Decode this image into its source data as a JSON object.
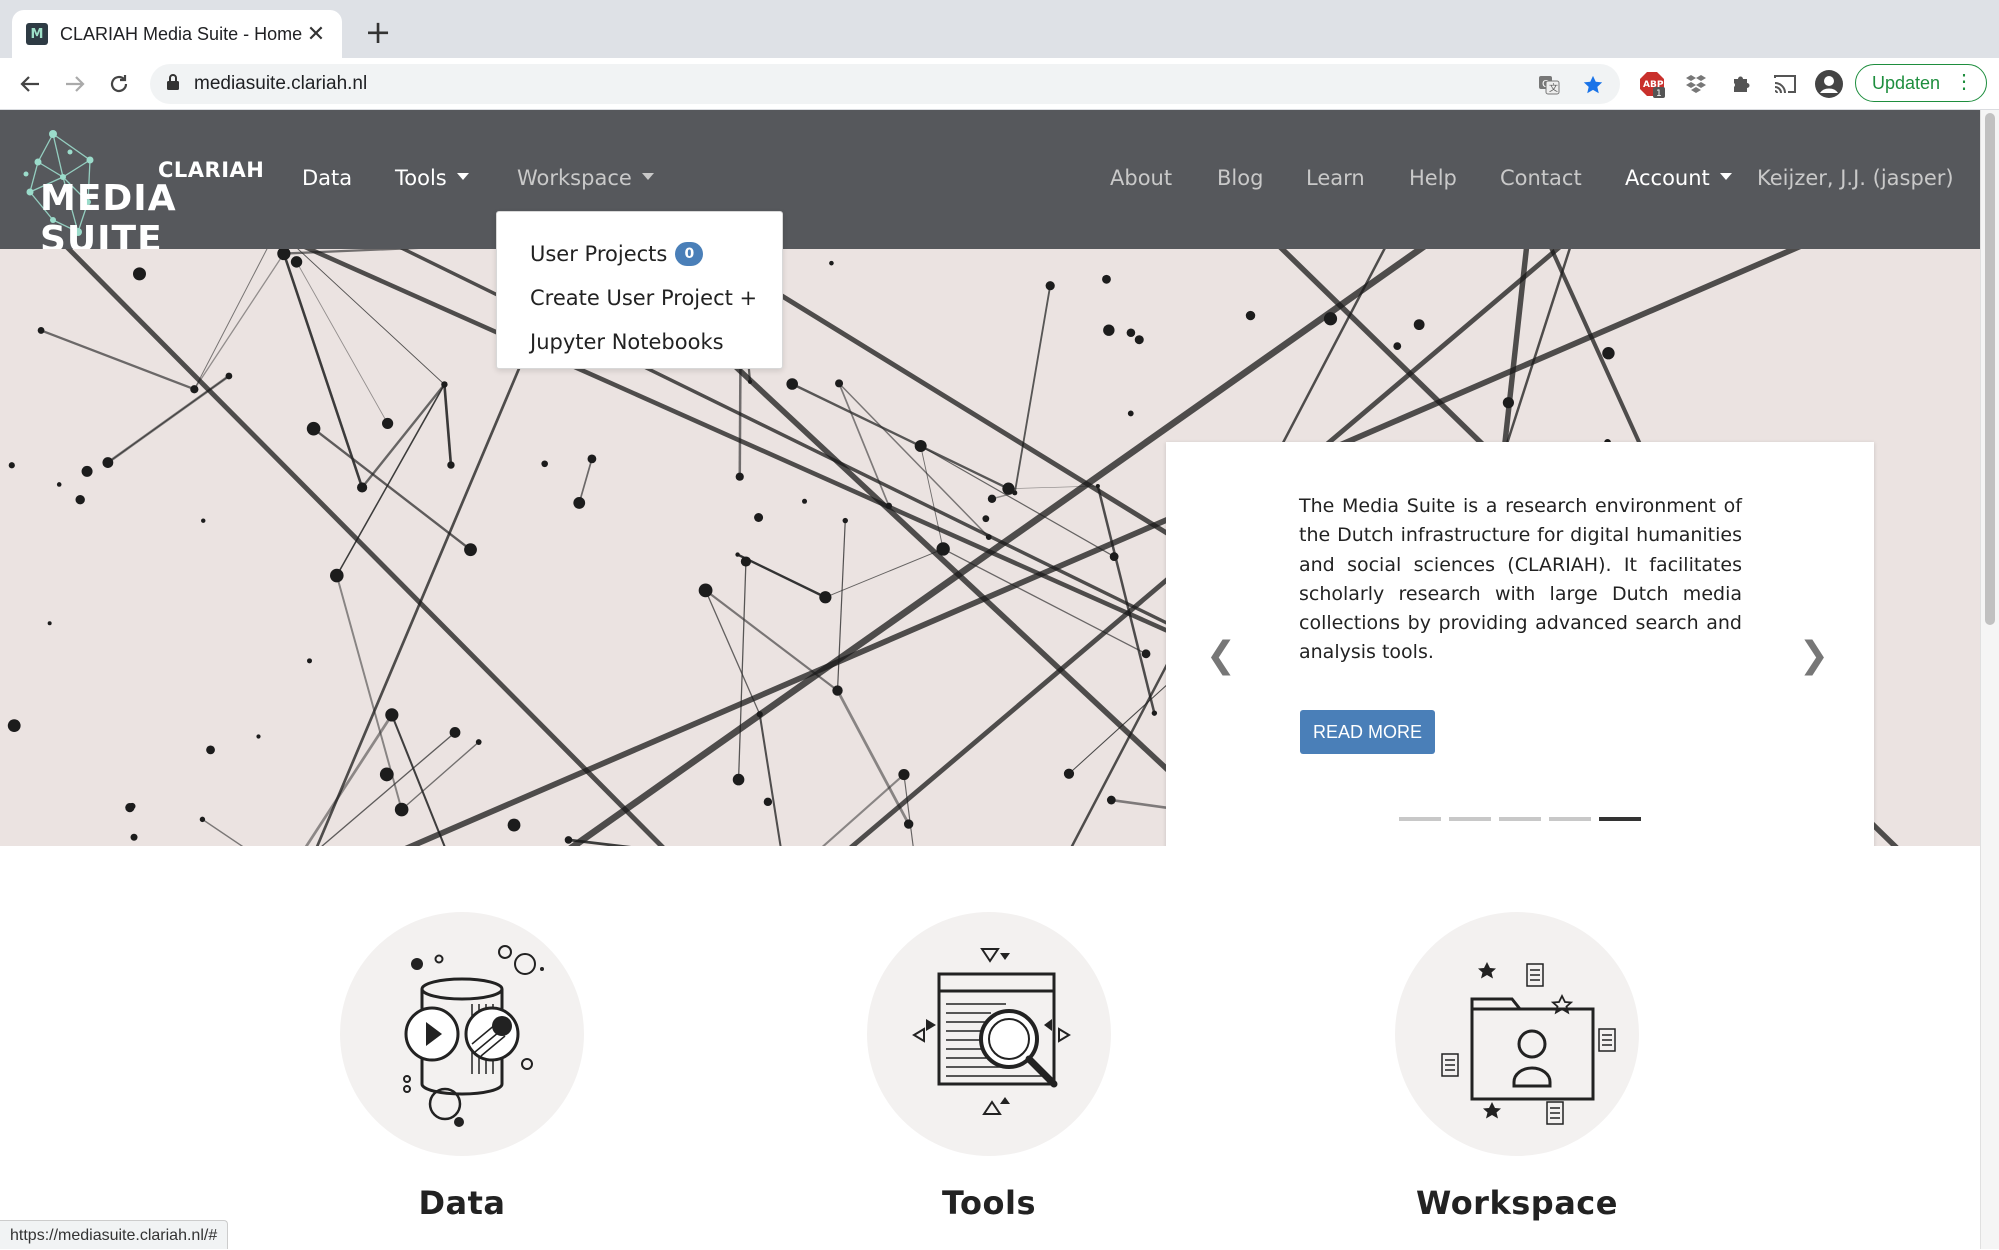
{
  "browser": {
    "tab_title": "CLARIAH Media Suite - Home",
    "favicon_text": "M",
    "url": "mediasuite.clariah.nl",
    "update_label": "Updaten",
    "status_url": "https://mediasuite.clariah.nl/#",
    "abp_count": "1"
  },
  "site": {
    "logo": {
      "line1": "CLARIAH",
      "line2": "MEDIA SUITE"
    },
    "nav_left": [
      {
        "label": "Data"
      },
      {
        "label": "Tools",
        "dropdown": true
      },
      {
        "label": "Workspace",
        "dropdown": true,
        "open": true
      }
    ],
    "nav_right": [
      {
        "label": "About"
      },
      {
        "label": "Blog"
      },
      {
        "label": "Learn"
      },
      {
        "label": "Help"
      },
      {
        "label": "Contact"
      },
      {
        "label": "Account",
        "dropdown": true
      },
      {
        "label": "Keijzer, J.J. (jasper)"
      }
    ],
    "workspace_menu": [
      {
        "label": "User Projects",
        "badge": "0"
      },
      {
        "label": "Create User Project +"
      },
      {
        "label": "Jupyter Notebooks"
      }
    ]
  },
  "carousel": {
    "text": "The Media Suite is a research environment of the Dutch infrastructure for digital humanities and social sciences (CLARIAH). It facilitates scholarly research with large Dutch media collections by providing advanced search and analysis tools.",
    "button_label": "READ MORE",
    "prev_glyph": "❮",
    "next_glyph": "❯",
    "slide_count": 5,
    "active_slide": 5
  },
  "features": [
    {
      "title": "Data",
      "icon": "data-cylinder-icon"
    },
    {
      "title": "Tools",
      "icon": "tools-search-icon"
    },
    {
      "title": "Workspace",
      "icon": "workspace-folder-icon"
    }
  ],
  "cut_text": [
    "... ...",
    "... ... ...",
    "... ... ..."
  ],
  "colors": {
    "nav_bg": "#56585c",
    "accent_blue": "#4a7fb8",
    "update_green": "#1e8e3e"
  }
}
